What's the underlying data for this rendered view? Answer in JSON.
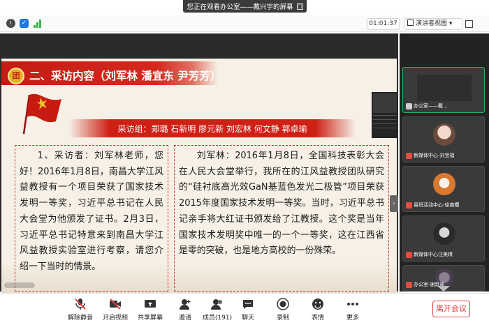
{
  "top_banner": {
    "label": "您正在观看办公室——戴兴宇的屏幕",
    "close_icon": "×"
  },
  "info_bar": {
    "timer": "01:01:37",
    "view_button_label": "演讲者视图"
  },
  "slide": {
    "title": "二、采访内容（刘军林 潘宜东 尹芳芳）",
    "subtitle": "采访组：郑璐 石新明 廖元新 刘宏林 何文静 郭卓瑜",
    "left_text": "1、采访者：刘军林老师，您好！2016年1月8日，南昌大学江风益教授有一个项目荣获了国家技术发明一等奖，习近平总书记在人民大会堂为他颁发了证书。2月3日，习近平总书记特意来到南昌大学江风益教授实验室进行考察，请您介绍一下当时的情景。",
    "right_text": "刘军林：2016年1月8日，全国科技表彰大会在人民大会堂举行，我所在的江风益教授团队研究的“硅衬底高光效GaN基蓝色发光二极管”项目荣获2015年度国家技术发明一等奖。当时，习近平总书记亲手将大红证书颁发给了江教授。这个奖是当年国家技术发明奖中唯一的一个一等奖，这在江西省是零的突破，也是地方高校的一份殊荣。"
  },
  "participants": [
    {
      "name": "办公室——戴..."
    },
    {
      "name": "新媒体中心-刘宝福"
    },
    {
      "name": "易班活动中心-徐南樱"
    },
    {
      "name": "新媒体中心汪美琪"
    },
    {
      "name": "办公室-谢廷册"
    }
  ],
  "toolbar": {
    "mute": "解除静音",
    "video": "开启视频",
    "share": "共享屏幕",
    "invite": "邀请",
    "members": "成员(191)",
    "chat": "聊天",
    "record": "录制",
    "reactions": "表情",
    "more": "更多",
    "leave": "离开会议"
  },
  "colors": {
    "slide_red": "#c31c14",
    "active_green": "#27b563",
    "leave_red": "#e04040"
  }
}
